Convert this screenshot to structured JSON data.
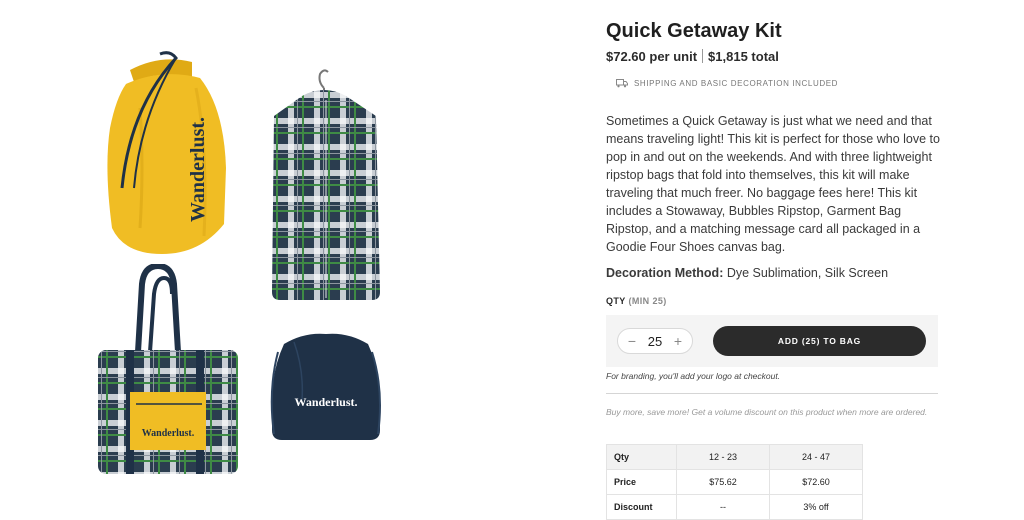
{
  "gallery": {
    "items": [
      {
        "name": "stowaway-laundry-bag",
        "print": "Wanderlust."
      },
      {
        "name": "garment-bag-ripstop",
        "print": ""
      },
      {
        "name": "goodie-four-shoes-canvas-bag",
        "print": "Wanderlust."
      },
      {
        "name": "bubbles-ripstop-drawstring-bag",
        "print": "Wanderlust."
      }
    ],
    "colors": {
      "yellow": "#f0bd24",
      "navy": "#1f3147",
      "plaid_light": "#c9ced4",
      "plaid_green": "#3f8b45"
    }
  },
  "product": {
    "title": "Quick Getaway Kit",
    "unit_price": "$72.60 per unit",
    "total_price": "$1,815 total",
    "shipping_note": "SHIPPING AND BASIC DECORATION INCLUDED",
    "description": "Sometimes a Quick Getaway is just what we need and that means traveling light! This kit is perfect for those who love to pop in and out on the weekends. And with three lightweight ripstop bags that fold into themselves, this kit will make traveling that much freer. No baggage fees here! This kit includes a Stowaway, Bubbles Ripstop, Garment Bag Ripstop, and a matching message card all packaged in a Goodie Four Shoes canvas bag.",
    "decoration_label": "Decoration Method:",
    "decoration_value": "Dye Sublimation, Silk Screen"
  },
  "order": {
    "qty_label": "QTY",
    "qty_min": "(MIN 25)",
    "decrement": "−",
    "increment": "+",
    "quantity": "25",
    "add_button": "ADD (25) TO BAG",
    "branding_note": "For branding, you'll add your logo at checkout.",
    "volume_note": "Buy more, save more! Get a volume discount on this product when more are ordered."
  },
  "volume_table": {
    "rows": [
      {
        "label": "Qty",
        "cols": [
          "12 - 23",
          "24 - 47"
        ]
      },
      {
        "label": "Price",
        "cols": [
          "$75.62",
          "$72.60"
        ]
      },
      {
        "label": "Discount",
        "cols": [
          "--",
          "3% off"
        ]
      }
    ]
  },
  "theme": {
    "button_bg": "#2b2b2b",
    "panel_bg": "#f4f4f4"
  }
}
